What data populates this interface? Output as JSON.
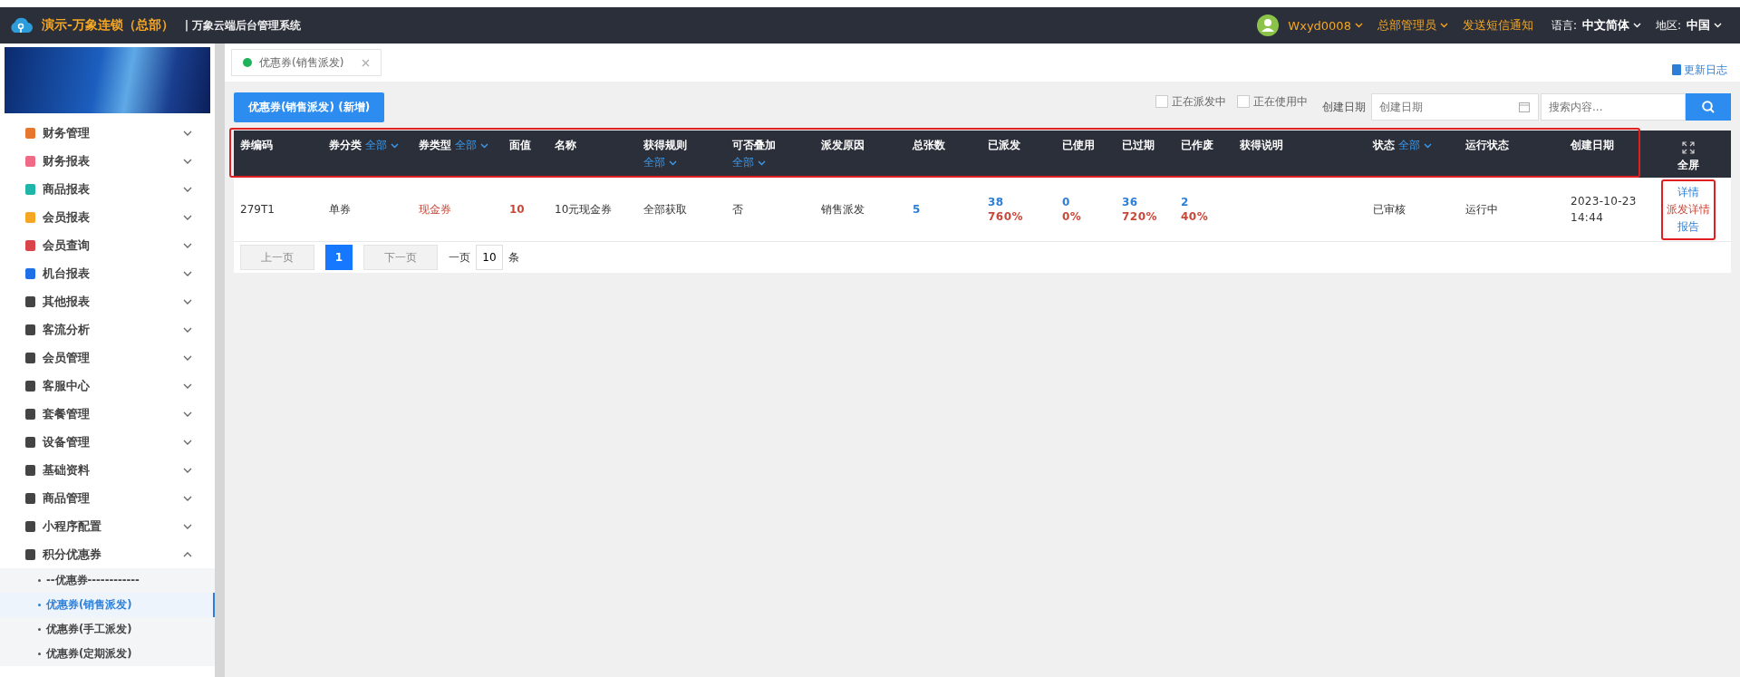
{
  "topbar": {
    "brand": "演示-万象连锁（总部）",
    "system": "| 万象云端后台管理系统",
    "user": "Wxyd0008",
    "role": "总部管理员",
    "notify": "发送短信通知",
    "language_label": "语言:",
    "language": "中文简体",
    "region_label": "地区:",
    "region": "中国"
  },
  "sidebar": {
    "items": [
      {
        "label": "财务管理",
        "expanded": false
      },
      {
        "label": "财务报表",
        "expanded": false
      },
      {
        "label": "商品报表",
        "expanded": false
      },
      {
        "label": "会员报表",
        "expanded": false
      },
      {
        "label": "会员查询",
        "expanded": false
      },
      {
        "label": "机台报表",
        "expanded": false
      },
      {
        "label": "其他报表",
        "expanded": false
      },
      {
        "label": "客流分析",
        "expanded": false
      },
      {
        "label": "会员管理",
        "expanded": false
      },
      {
        "label": "客服中心",
        "expanded": false
      },
      {
        "label": "套餐管理",
        "expanded": false
      },
      {
        "label": "设备管理",
        "expanded": false
      },
      {
        "label": "基础资料",
        "expanded": false
      },
      {
        "label": "商品管理",
        "expanded": false
      },
      {
        "label": "小程序配置",
        "expanded": false
      },
      {
        "label": "积分优惠券",
        "expanded": true,
        "children": [
          {
            "label": "--优惠券------------",
            "selected": false
          },
          {
            "label": "优惠券(销售派发)",
            "selected": true
          },
          {
            "label": "优惠券(手工派发)",
            "selected": false
          },
          {
            "label": "优惠券(定期派发)",
            "selected": false
          }
        ]
      }
    ]
  },
  "tabs": [
    {
      "label": "优惠券(销售派发)",
      "selected": true
    }
  ],
  "changelog": "更新日志",
  "toolbar": {
    "add_button": "优惠券(销售派发) (新增)",
    "checkboxes": [
      {
        "label": "正在派发中",
        "checked": false
      },
      {
        "label": "正在使用中",
        "checked": false
      }
    ],
    "date_label": "创建日期",
    "date_placeholder": "创建日期",
    "search_placeholder": "搜索内容..."
  },
  "table": {
    "columns": [
      {
        "label": "券编码",
        "kind": "plain"
      },
      {
        "label": "券分类",
        "kind": "filter_inline",
        "filter": "全部"
      },
      {
        "label": "券类型",
        "kind": "filter_inline",
        "filter": "全部"
      },
      {
        "label": "面值",
        "kind": "plain"
      },
      {
        "label": "名称",
        "kind": "plain"
      },
      {
        "label": "获得规则",
        "kind": "filter_below",
        "filter": "全部"
      },
      {
        "label": "可否叠加",
        "kind": "filter_below",
        "filter": "全部"
      },
      {
        "label": "派发原因",
        "kind": "plain"
      },
      {
        "label": "总张数",
        "kind": "plain"
      },
      {
        "label": "已派发",
        "kind": "plain"
      },
      {
        "label": "已使用",
        "kind": "plain"
      },
      {
        "label": "已过期",
        "kind": "plain"
      },
      {
        "label": "已作废",
        "kind": "plain"
      },
      {
        "label": "获得说明",
        "kind": "plain"
      },
      {
        "label": "状态",
        "kind": "filter_inline",
        "filter": "全部"
      },
      {
        "label": "运行状态",
        "kind": "plain"
      },
      {
        "label": "创建日期",
        "kind": "plain"
      },
      {
        "label": "全屏",
        "kind": "fullscreen"
      }
    ],
    "rows": [
      {
        "cells": [
          {
            "kind": "text",
            "text": "279T1"
          },
          {
            "kind": "text",
            "text": "单券"
          },
          {
            "kind": "red",
            "text": "现金券"
          },
          {
            "kind": "red_bold",
            "text": "10"
          },
          {
            "kind": "text",
            "text": "10元现金券"
          },
          {
            "kind": "text",
            "text": "全部获取"
          },
          {
            "kind": "text",
            "text": "否"
          },
          {
            "kind": "text",
            "text": "销售派发"
          },
          {
            "kind": "blue_bold",
            "text": "5"
          },
          {
            "kind": "stat",
            "value": "38",
            "percent": "760%"
          },
          {
            "kind": "stat",
            "value": "0",
            "percent": "0%"
          },
          {
            "kind": "stat",
            "value": "36",
            "percent": "720%"
          },
          {
            "kind": "stat",
            "value": "2",
            "percent": "40%"
          },
          {
            "kind": "empty"
          },
          {
            "kind": "text",
            "text": "已审核"
          },
          {
            "kind": "text",
            "text": "运行中"
          },
          {
            "kind": "date",
            "text": "2023-10-23 14:44"
          },
          {
            "kind": "actions",
            "actions": [
              {
                "label": "详情",
                "kind": "link"
              },
              {
                "label": "派发详情",
                "kind": "danger"
              },
              {
                "label": "报告",
                "kind": "link"
              }
            ]
          }
        ]
      }
    ]
  },
  "pagination": {
    "prev": "上一页",
    "pages": [
      {
        "label": "1",
        "selected": true
      }
    ],
    "next": "下一页",
    "per_page_label": "一页",
    "per_page": "10",
    "unit": "条"
  },
  "highlights": {
    "header": true,
    "actions": true
  }
}
